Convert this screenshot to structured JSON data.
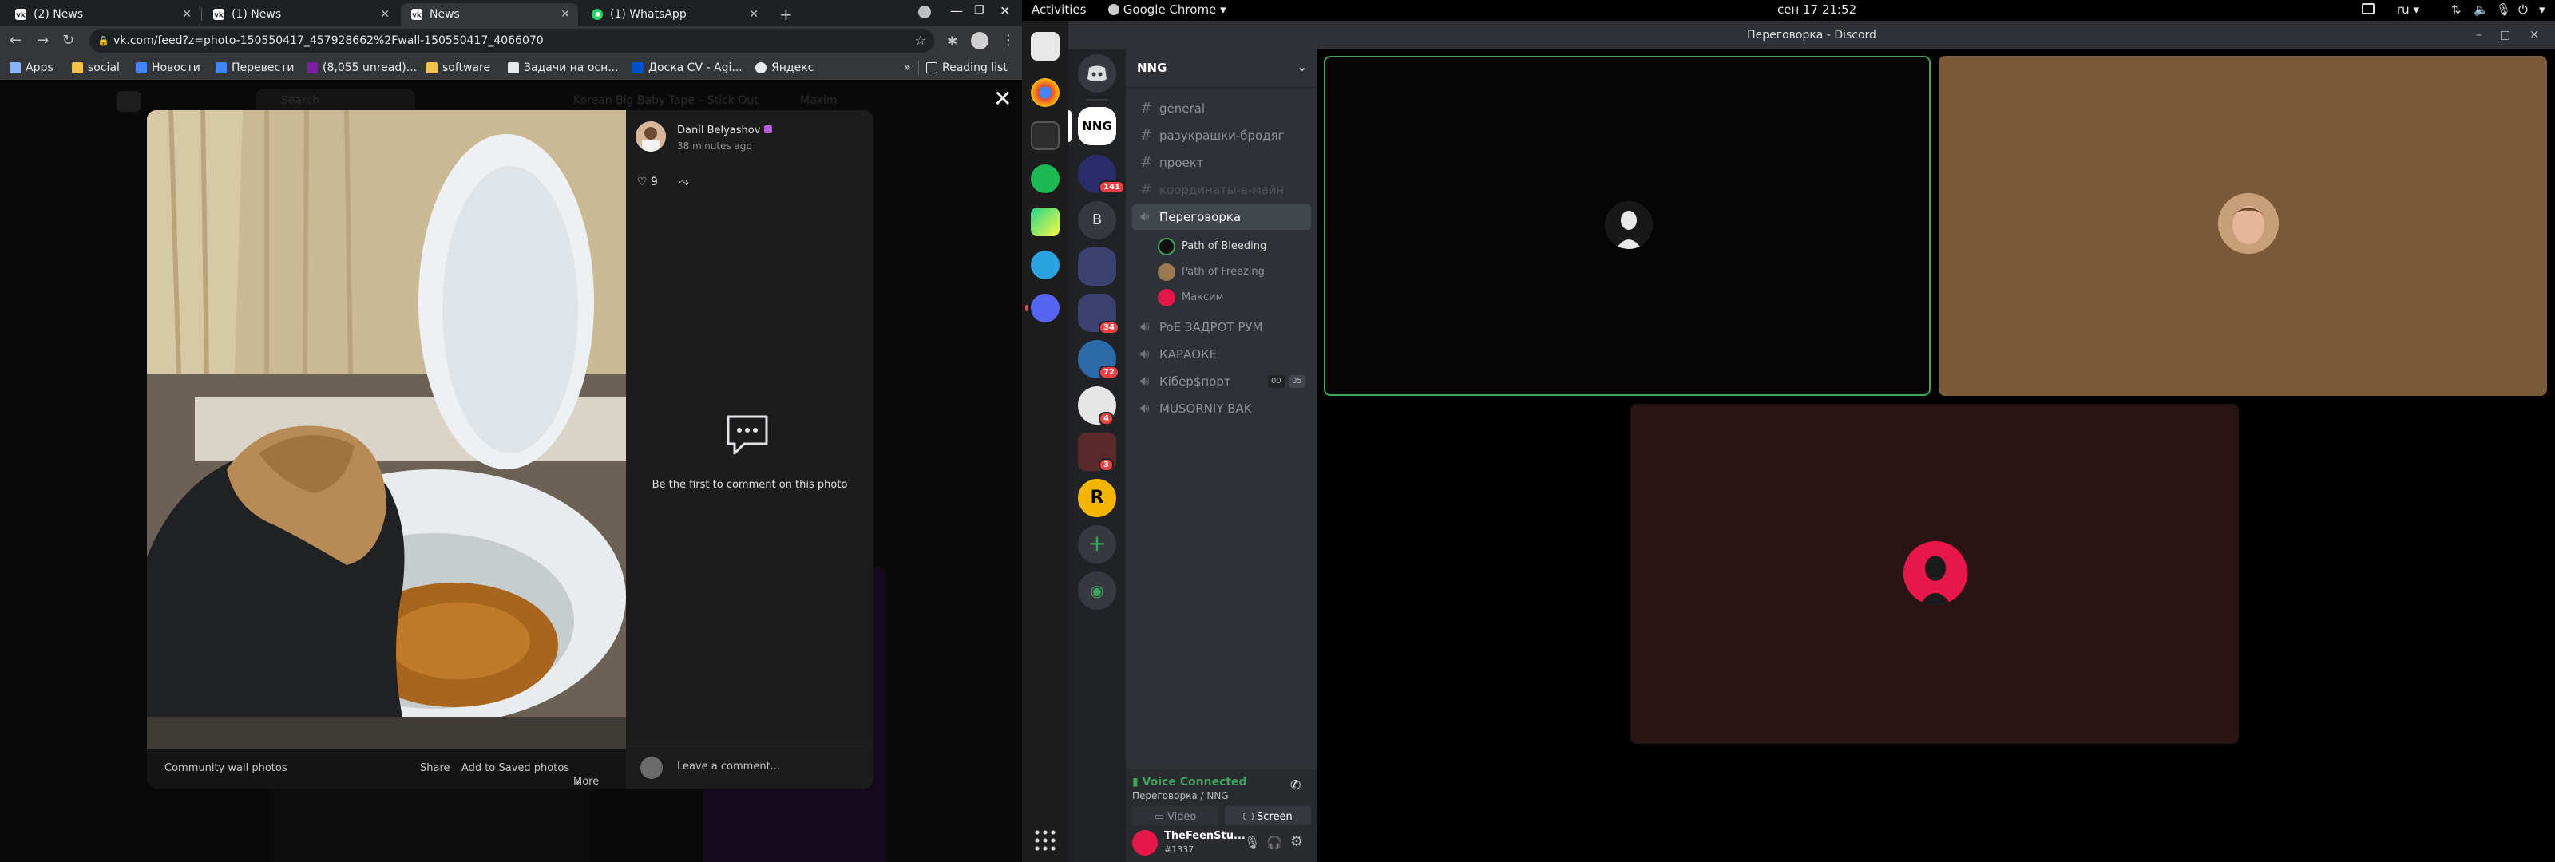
{
  "chrome": {
    "tabs": [
      {
        "label": "(2) News",
        "icon": "vk-icon"
      },
      {
        "label": "(1) News",
        "icon": "vk-icon"
      },
      {
        "label": "News",
        "icon": "vk-icon"
      },
      {
        "label": "(1) WhatsApp",
        "icon": "whatsapp-icon"
      }
    ],
    "url": "vk.com/feed?z=photo-150550417_457928662%2Fwall-150550417_4066070",
    "bookmarks": [
      {
        "label": "Apps"
      },
      {
        "label": "social"
      },
      {
        "label": "Новости"
      },
      {
        "label": "Перевести"
      },
      {
        "label": "(8,055 unread)..."
      },
      {
        "label": "software"
      },
      {
        "label": "Задачи на осн..."
      },
      {
        "label": "Доска CV - Agi..."
      },
      {
        "label": "Яндекс"
      }
    ],
    "bookmarks_more": "»",
    "reading_list": "Reading list"
  },
  "vk": {
    "search_placeholder": "Search",
    "player_track": "Korean Big Baby Tape – Stick Out",
    "user_short": "Maxim",
    "post": {
      "author": "Danil Belyashov",
      "time": "38 minutes ago",
      "likes": "9",
      "empty_comments": "Be the first to comment on this photo",
      "leave_comment": "Leave a comment..."
    },
    "photo_bar": {
      "album": "Community wall photos",
      "share": "Share",
      "save": "Add to Saved photos",
      "more": "More"
    }
  },
  "gnome": {
    "activities": "Activities",
    "app": "Google Chrome",
    "clock": "сен 17  21:52",
    "lang": "ru"
  },
  "discord": {
    "window_title": "Переговорка - Discord",
    "server_name": "NNG",
    "server_icon_text": "NNG",
    "letter_server": "B",
    "badges": [
      "141",
      "34",
      "72",
      "4",
      "3"
    ],
    "text_channels": [
      "general",
      "разукрашки-бродяг",
      "проект",
      "координаты-в-майн"
    ],
    "voice_channel_active": "Переговорка",
    "voice_users": [
      "Path of Bleeding",
      "Path of Freezing",
      "Максим"
    ],
    "voice_channels": [
      "PoE ЗАДРОТ РУМ",
      "КАРАОКЕ",
      "Кібер$порт",
      "MUSORNIY BAK"
    ],
    "kiber_counts": [
      "00",
      "05"
    ],
    "voice_status": "Voice Connected",
    "voice_location": "Переговорка / NNG",
    "video_label": "Video",
    "screen_label": "Screen",
    "username": "TheFeenStu...",
    "discriminator": "#1337"
  },
  "colors": {
    "discord_green": "#3ba55c",
    "discord_blurple": "#5865f2",
    "badge_red": "#ed4245",
    "tile_brown": "#7a5a36",
    "tile_maroon": "#2a1314"
  }
}
